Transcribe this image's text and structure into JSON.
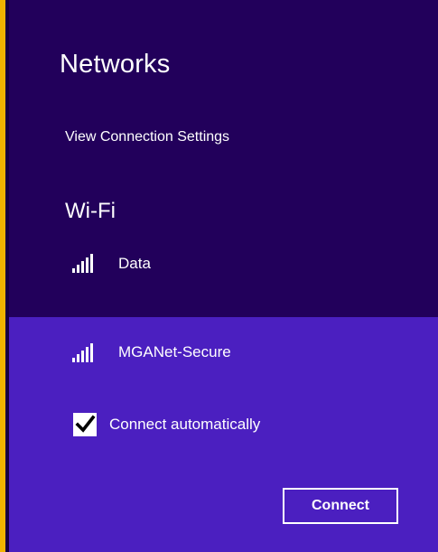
{
  "header": {
    "title": "Networks",
    "settings_link": "View Connection Settings"
  },
  "wifi": {
    "section_title": "Wi-Fi",
    "networks": [
      {
        "name": "Data",
        "icon": "wifi-signal-icon",
        "selected": false
      },
      {
        "name": "MGANet-Secure",
        "icon": "wifi-signal-icon",
        "selected": true
      }
    ],
    "connect_automatically": {
      "label": "Connect automatically",
      "checked": true
    },
    "connect_button": "Connect"
  },
  "colors": {
    "background": "#22005b",
    "selected_background": "#4b1fc0",
    "accent": "#f0b400",
    "text": "#ffffff"
  }
}
